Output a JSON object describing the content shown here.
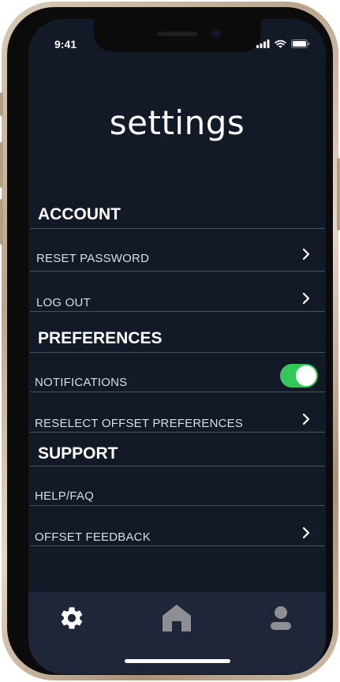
{
  "status_bar": {
    "time": "9:41"
  },
  "page": {
    "title": "settings"
  },
  "sections": {
    "account": {
      "heading": "ACCOUNT",
      "items": [
        {
          "label": "RESET PASSWORD",
          "control": "chevron-right-icon"
        },
        {
          "label": "LOG OUT",
          "control": "chevron-right-icon"
        }
      ]
    },
    "preferences": {
      "heading": "PREFERENCES",
      "items": [
        {
          "label": "NOTIFICATIONS",
          "control": "toggle",
          "value": true
        },
        {
          "label": "RESELECT OFFSET PREFERENCES",
          "control": "chevron-right-icon"
        }
      ]
    },
    "support": {
      "heading": "SUPPORT",
      "items": [
        {
          "label": "HELP/FAQ",
          "control": "none"
        },
        {
          "label": "OFFSET FEEDBACK",
          "control": "chevron-right-icon"
        }
      ]
    }
  },
  "tab_bar": {
    "tabs": [
      {
        "icon": "gear-icon",
        "active": true
      },
      {
        "icon": "home-icon",
        "active": false
      },
      {
        "icon": "profile-icon",
        "active": false
      }
    ]
  },
  "colors": {
    "background": "#121a28",
    "tab_bar": "#1f2638",
    "toggle_on": "#34c759",
    "active_icon": "#ffffff",
    "inactive_icon": "#8d8f94"
  }
}
